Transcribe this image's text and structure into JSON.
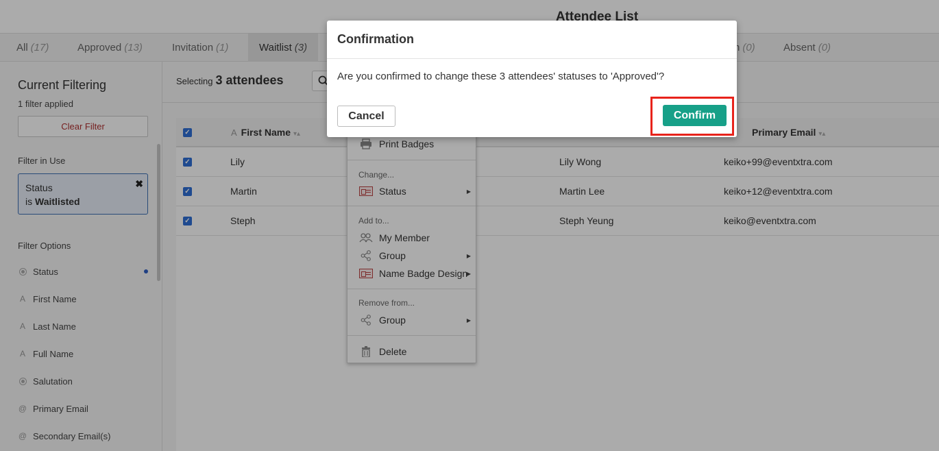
{
  "page_title": "Attendee List",
  "tabs": [
    {
      "label": "All",
      "count": "(17)"
    },
    {
      "label": "Approved",
      "count": "(13)"
    },
    {
      "label": "Invitation",
      "count": "(1)"
    },
    {
      "label": "Waitlist",
      "count": "(3)"
    },
    {
      "label": "n",
      "count": "(0)"
    },
    {
      "label": "Absent",
      "count": "(0)"
    }
  ],
  "sidebar": {
    "title": "Current Filtering",
    "filters_applied": "1 filter applied",
    "clear_filter": "Clear Filter",
    "filter_in_use_title": "Filter in Use",
    "chip": {
      "line1": "Status",
      "prefix": "is",
      "value": "Waitlisted",
      "close": "✖"
    },
    "filter_options_title": "Filter Options",
    "options": [
      {
        "label": "Status",
        "icon": "radio-icon",
        "active": true
      },
      {
        "label": "First Name",
        "icon": "text-icon"
      },
      {
        "label": "Last Name",
        "icon": "text-icon"
      },
      {
        "label": "Full Name",
        "icon": "text-icon"
      },
      {
        "label": "Salutation",
        "icon": "radio-icon"
      },
      {
        "label": "Primary Email",
        "icon": "at-icon"
      },
      {
        "label": "Secondary Email(s)",
        "icon": "at-icon"
      }
    ]
  },
  "selection": {
    "prefix": "Selecting",
    "count": "3 attendees"
  },
  "table": {
    "headers": {
      "first_name": "First Name",
      "primary_email": "Primary Email"
    },
    "rows": [
      {
        "first": "Lily",
        "full": "Lily Wong",
        "email": "keiko+99@eventxtra.com"
      },
      {
        "first": "Martin",
        "full": "Martin Lee",
        "email": "keiko+12@eventxtra.com"
      },
      {
        "first": "Steph",
        "full": "Steph Yeung",
        "email": "keiko@eventxtra.com"
      }
    ]
  },
  "menu": {
    "print_badges": "Print Badges",
    "change_head": "Change...",
    "status": "Status",
    "add_head": "Add to...",
    "my_member": "My Member",
    "group": "Group",
    "name_badge_design": "Name Badge Design",
    "remove_head": "Remove from...",
    "remove_group": "Group",
    "delete": "Delete"
  },
  "modal": {
    "title": "Confirmation",
    "message": "Are you confirmed to change these 3 attendees' statuses to 'Approved'?",
    "cancel": "Cancel",
    "confirm": "Confirm"
  },
  "colors": {
    "confirm": "#17a088",
    "highlight": "#e8231b",
    "checkbox": "#2f6fd6",
    "clear_filter": "#b03030"
  }
}
